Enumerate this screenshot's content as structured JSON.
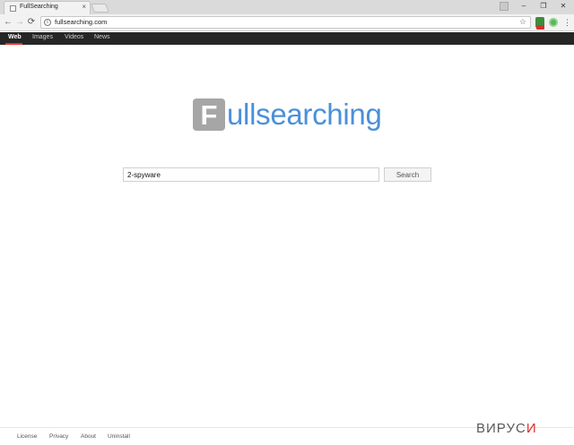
{
  "browser": {
    "tab_title": "FullSearching",
    "tab_close": "×",
    "url": "fullsearching.com",
    "nav_back": "←",
    "nav_forward": "→",
    "nav_reload": "⟳",
    "info": "i",
    "star": "☆",
    "menu": "⋮",
    "window_minimize": "–",
    "window_restore": "❐",
    "window_close": "✕"
  },
  "topnav": {
    "items": [
      {
        "label": "Web",
        "active": true
      },
      {
        "label": "Images",
        "active": false
      },
      {
        "label": "Videos",
        "active": false
      },
      {
        "label": "News",
        "active": false
      }
    ]
  },
  "logo": {
    "letter": "F",
    "text": "ullsearching"
  },
  "search": {
    "value": "2-spyware",
    "button_label": "Search"
  },
  "footer": {
    "links": [
      "License",
      "Privacy",
      "About",
      "Uninstall"
    ]
  },
  "watermark": {
    "main": "ВИРУС",
    "accent": "И"
  },
  "colors": {
    "nav_bg": "#262626",
    "nav_accent": "#e8322e",
    "logo_blue": "#4a90d9",
    "logo_box": "#a6a6a6"
  }
}
